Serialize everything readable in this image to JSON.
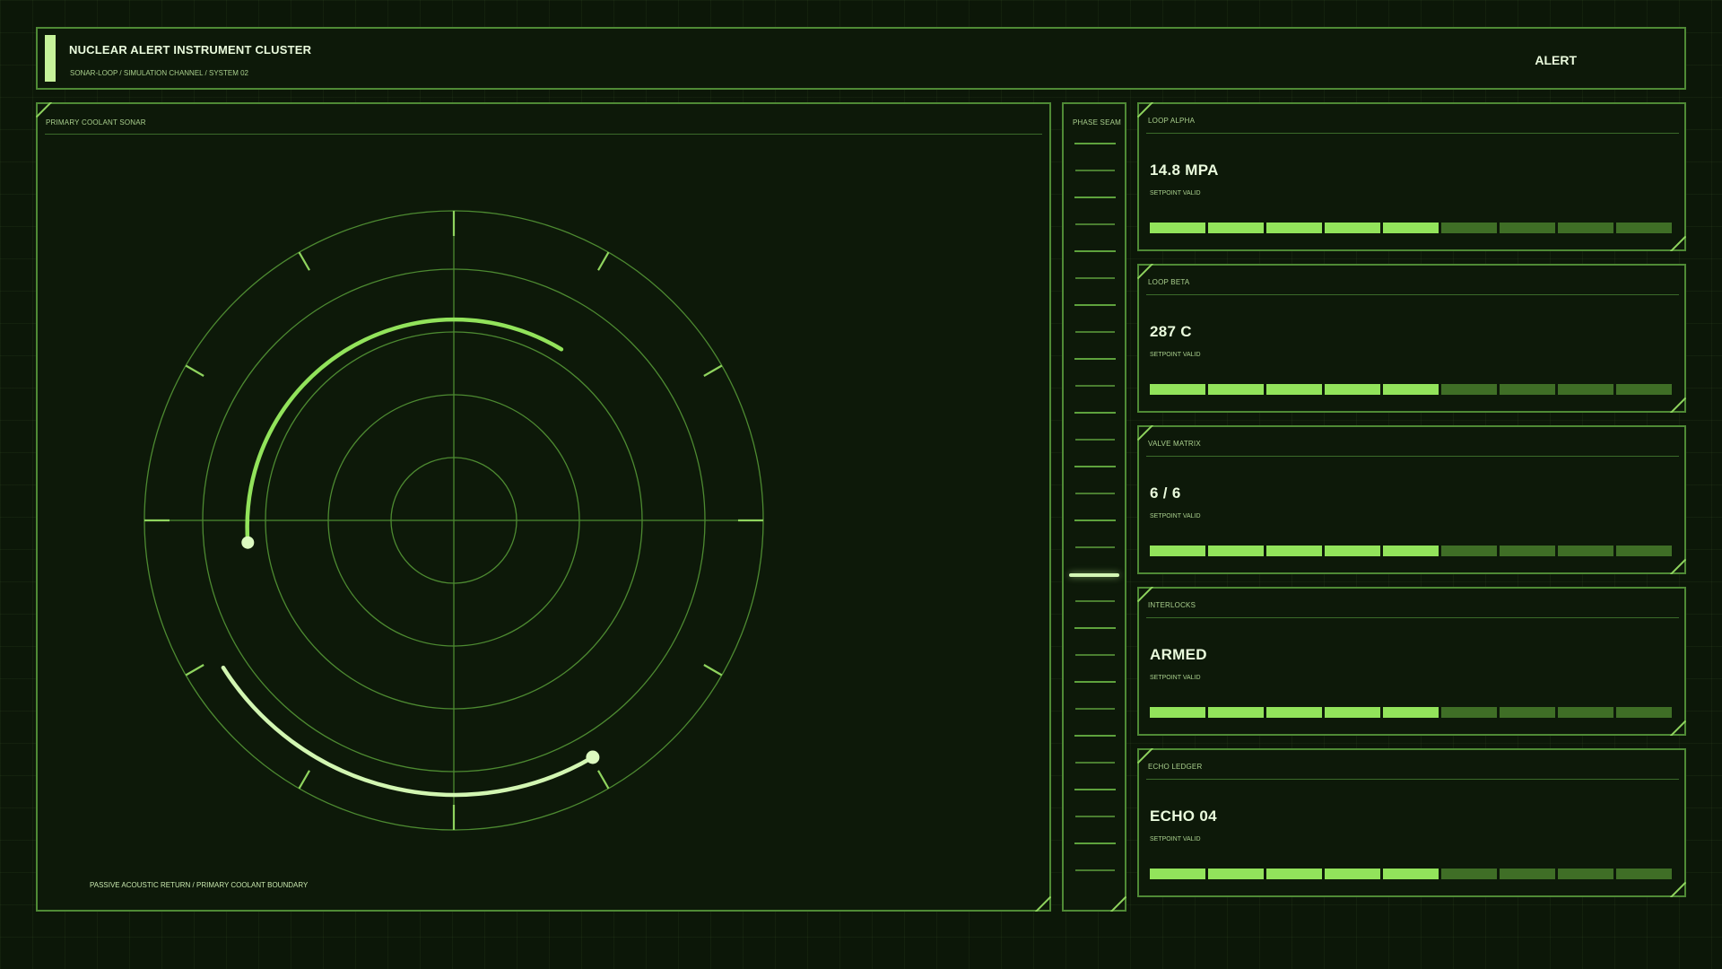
{
  "header": {
    "title": "NUCLEAR ALERT INSTRUMENT CLUSTER",
    "subtitle": "SONAR-LOOP / SIMULATION CHANNEL / SYSTEM 02",
    "status": "ALERT"
  },
  "sonar": {
    "label": "PRIMARY COOLANT SONAR",
    "footer": "PASSIVE ACOUSTIC RETURN / PRIMARY COOLANT BOUNDARY"
  },
  "phase": {
    "label": "PHASE SEAM",
    "tick_count": 28,
    "active_tick": 16
  },
  "cards": [
    {
      "label": "LOOP ALPHA",
      "value": "14.8 MPA",
      "status": "SETPOINT VALID",
      "filled": 5,
      "total": 9
    },
    {
      "label": "LOOP BETA",
      "value": "287 C",
      "status": "SETPOINT VALID",
      "filled": 5,
      "total": 9
    },
    {
      "label": "VALVE MATRIX",
      "value": "6 / 6",
      "status": "SETPOINT VALID",
      "filled": 5,
      "total": 9
    },
    {
      "label": "INTERLOCKS",
      "value": "ARMED",
      "status": "SETPOINT VALID",
      "filled": 5,
      "total": 9
    },
    {
      "label": "ECHO LEDGER",
      "value": "ECHO 04",
      "status": "SETPOINT VALID",
      "filled": 5,
      "total": 9
    }
  ],
  "colors": {
    "background": "#0c1708",
    "frame": "#4f8a35",
    "accent": "#92e35b",
    "highlight": "#d3f6b4"
  }
}
